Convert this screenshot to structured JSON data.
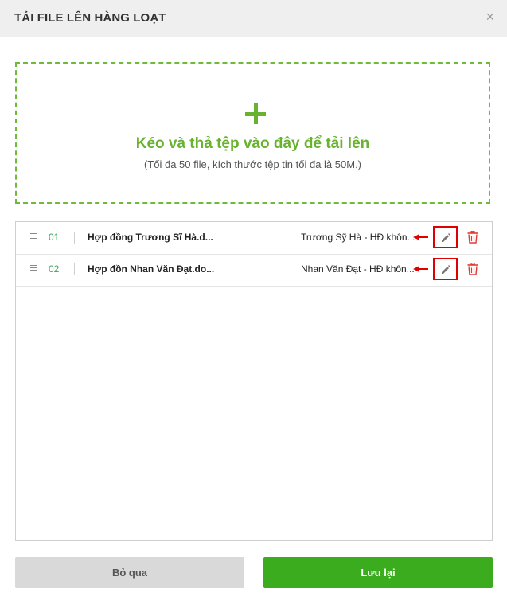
{
  "dialog": {
    "title": "TẢI FILE LÊN HÀNG LOẠT",
    "close": "×"
  },
  "dropzone": {
    "title": "Kéo và thả tệp vào đây để tải lên",
    "subtitle": "(Tối đa 50 file, kích thước tệp tin tối đa là 50M.)"
  },
  "files": [
    {
      "num": "01",
      "name": "Hợp đồng Trương Sĩ Hà.d...",
      "desc": "Trương Sỹ Hà - HĐ khôn..."
    },
    {
      "num": "02",
      "name": "Hợp đồn Nhan Văn Đạt.do...",
      "desc": "Nhan Văn Đạt - HĐ khôn..."
    }
  ],
  "footer": {
    "skip_label": "Bỏ qua",
    "save_label": "Lưu lại"
  },
  "colors": {
    "accent": "#67b22e",
    "save": "#3aac1d",
    "highlight": "#e00000",
    "delete": "#e53935"
  }
}
